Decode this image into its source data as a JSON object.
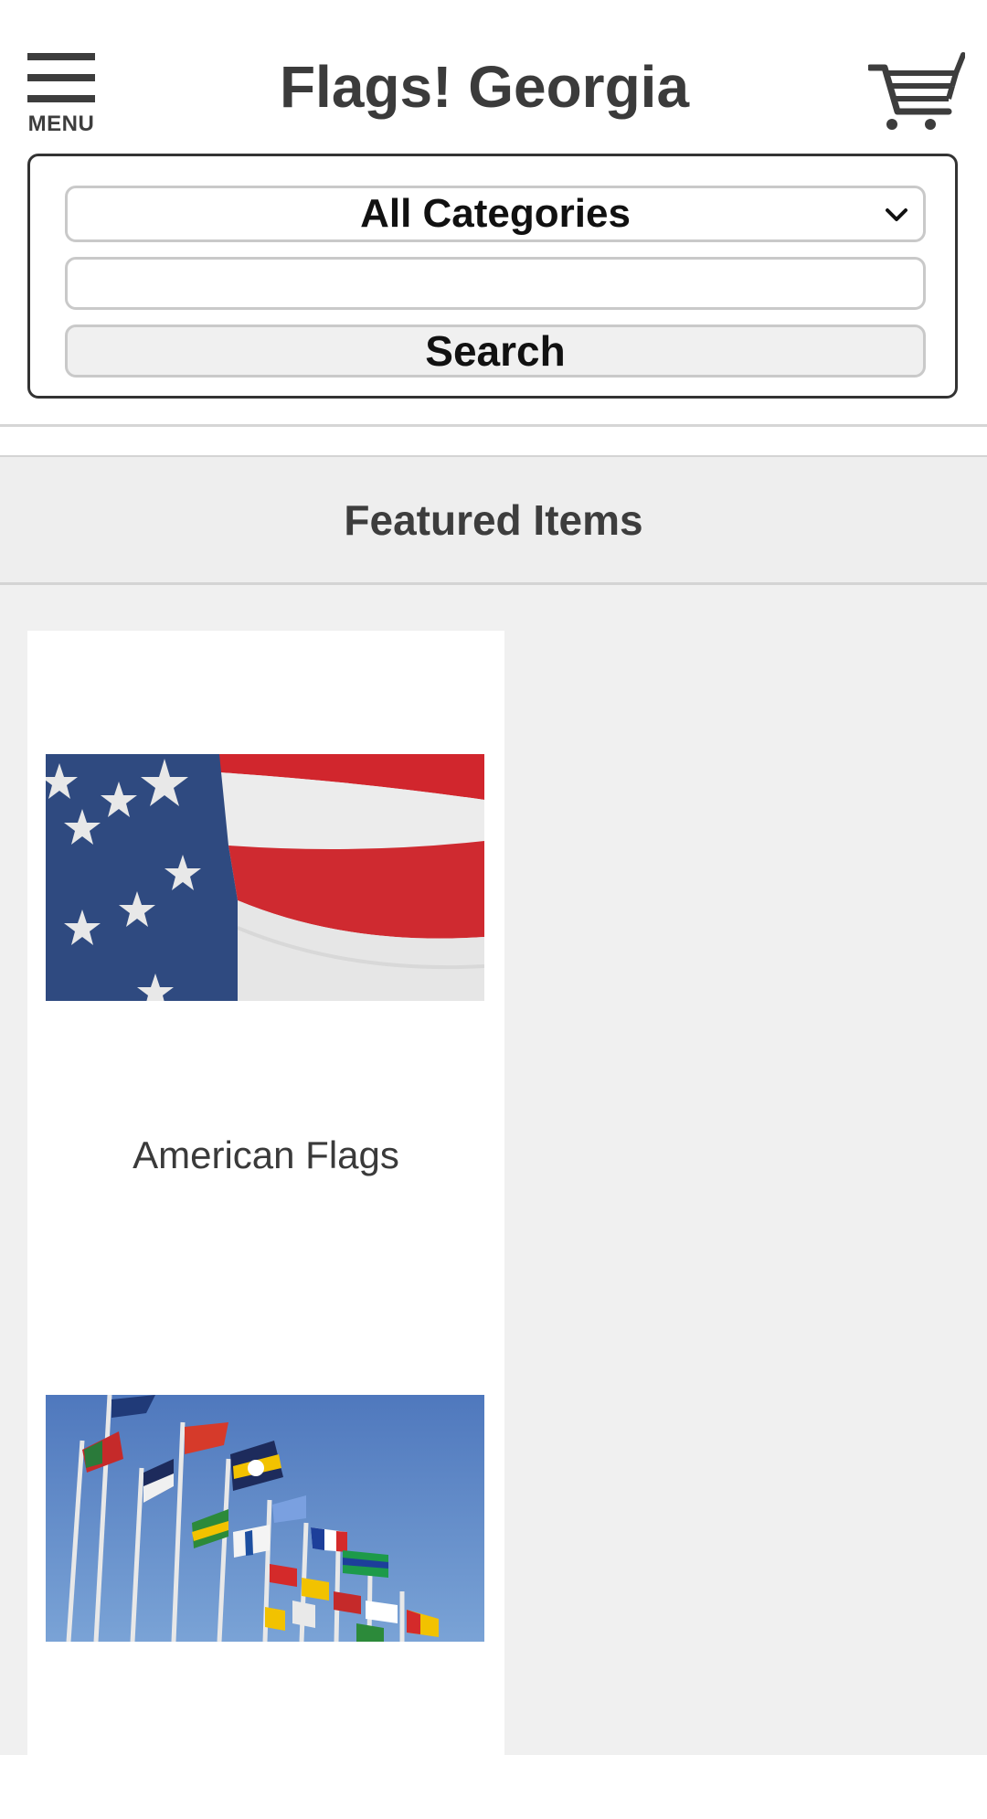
{
  "header": {
    "menu_label": "MENU",
    "title": "Flags! Georgia",
    "menu_icon": "hamburger-icon",
    "cart_icon": "shopping-cart-icon"
  },
  "search": {
    "category_selected": "All Categories",
    "query_value": "",
    "button_label": "Search"
  },
  "featured": {
    "title": "Featured Items",
    "items": [
      {
        "label": "American Flags",
        "image": "american-flag-image"
      },
      {
        "label": "",
        "image": "international-flags-image"
      }
    ]
  },
  "colors": {
    "text_dark": "#3a3a3a",
    "gray_bg": "#f0f0f0",
    "flag_red": "#c8242b",
    "flag_blue": "#2e4a80",
    "sky_blue": "#5a86c4"
  }
}
